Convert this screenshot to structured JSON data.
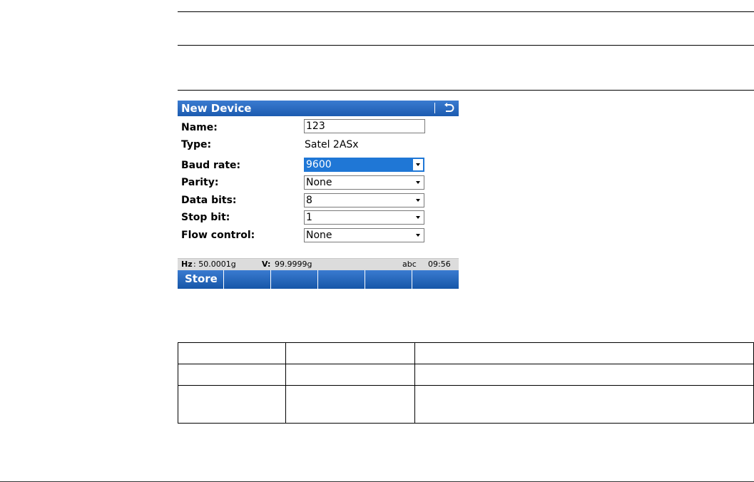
{
  "dialog": {
    "title": "New Device",
    "back_icon": "back-arrow-icon",
    "fields": {
      "name": {
        "label": "Name:",
        "value": "123"
      },
      "type": {
        "label": "Type:",
        "value": "Satel 2ASx"
      },
      "baud_rate": {
        "label": "Baud rate:",
        "value": "9600"
      },
      "parity": {
        "label": "Parity:",
        "value": "None"
      },
      "data_bits": {
        "label": "Data bits:",
        "value": "8"
      },
      "stop_bit": {
        "label": "Stop bit:",
        "value": "1"
      },
      "flow_control": {
        "label": "Flow control:",
        "value": "None"
      }
    },
    "status": {
      "hz_label": "Hz",
      "hz_value": ": 50.0001g",
      "v_label": "V:",
      "v_value": "99.9999g",
      "input_mode": "abc",
      "time": "09:56"
    },
    "softkeys": [
      "Store",
      "",
      "",
      "",
      "",
      ""
    ]
  },
  "colors": {
    "titlebar": "#1c5bb0",
    "selection": "#1f77d6"
  }
}
